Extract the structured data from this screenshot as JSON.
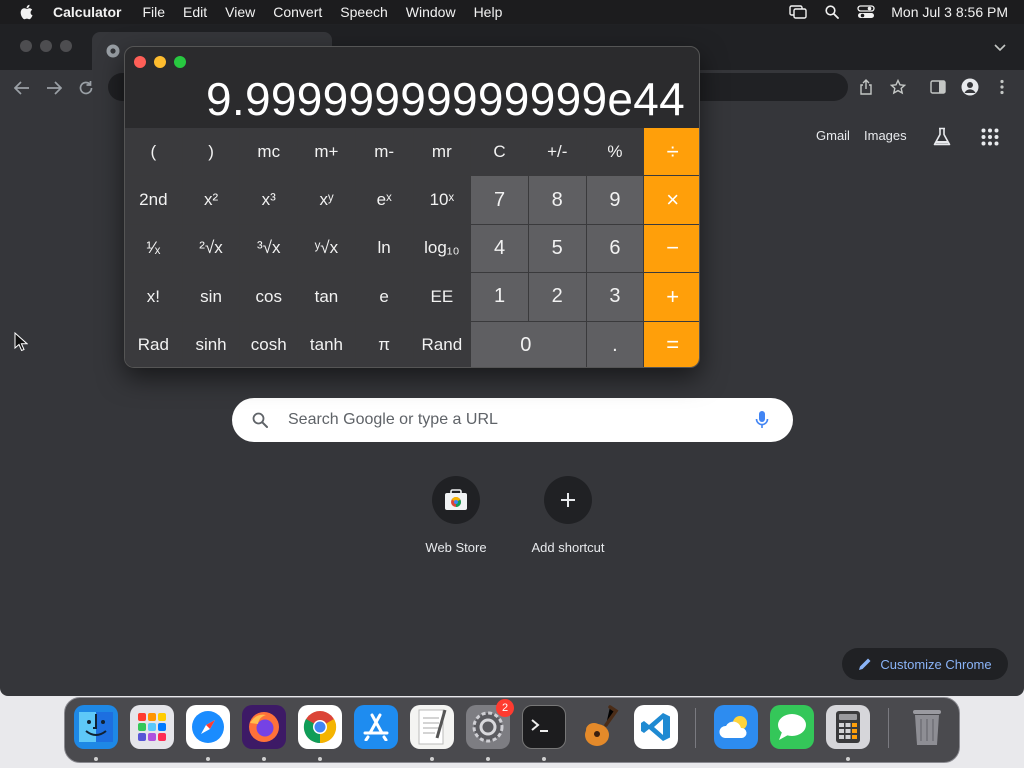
{
  "menubar": {
    "app_name": "Calculator",
    "items": [
      "File",
      "Edit",
      "View",
      "Convert",
      "Speech",
      "Window",
      "Help"
    ],
    "clock": "Mon Jul 3  8:56 PM",
    "icons": [
      "apple-icon",
      "screen-mirroring-icon",
      "spotlight-search-icon",
      "control-center-icon"
    ]
  },
  "calculator": {
    "display": "9.99999999999999e44",
    "rows": [
      [
        {
          "label": "("
        },
        {
          "label": ")"
        },
        {
          "label": "mc"
        },
        {
          "label": "m+"
        },
        {
          "label": "m-"
        },
        {
          "label": "mr"
        },
        {
          "label": "C"
        },
        {
          "label": "+/-"
        },
        {
          "label": "%"
        },
        {
          "label": "÷"
        }
      ],
      [
        {
          "label": "2nd"
        },
        {
          "label": "x²"
        },
        {
          "label": "x³"
        },
        {
          "label": "xʸ"
        },
        {
          "label": "eˣ"
        },
        {
          "label": "10ˣ"
        },
        {
          "label": "7"
        },
        {
          "label": "8"
        },
        {
          "label": "9"
        },
        {
          "label": "×"
        }
      ],
      [
        {
          "label": "¹⁄ₓ"
        },
        {
          "label": "²√x"
        },
        {
          "label": "³√x"
        },
        {
          "label": "ʸ√x"
        },
        {
          "label": "ln"
        },
        {
          "label": "log₁₀"
        },
        {
          "label": "4"
        },
        {
          "label": "5"
        },
        {
          "label": "6"
        },
        {
          "label": "−"
        }
      ],
      [
        {
          "label": "x!"
        },
        {
          "label": "sin"
        },
        {
          "label": "cos"
        },
        {
          "label": "tan"
        },
        {
          "label": "e"
        },
        {
          "label": "EE"
        },
        {
          "label": "1"
        },
        {
          "label": "2"
        },
        {
          "label": "3"
        },
        {
          "label": "+"
        }
      ],
      [
        {
          "label": "Rad"
        },
        {
          "label": "sinh"
        },
        {
          "label": "cosh"
        },
        {
          "label": "tanh"
        },
        {
          "label": "π"
        },
        {
          "label": "Rand"
        },
        {
          "label": "0"
        },
        {
          "label": "."
        },
        {
          "label": "="
        }
      ]
    ]
  },
  "chrome": {
    "header_links": {
      "gmail": "Gmail",
      "images": "Images"
    },
    "search": {
      "placeholder": "Search Google or type a URL"
    },
    "shortcuts": [
      {
        "label": "Web Store"
      },
      {
        "label": "Add shortcut"
      }
    ],
    "customize_label": "Customize Chrome"
  },
  "dock": {
    "apps": [
      "finder",
      "launchpad",
      "safari",
      "firefox",
      "chrome",
      "app-store",
      "textedit",
      "system-settings",
      "terminal",
      "garageband",
      "vscode",
      "weather",
      "messages",
      "calculator",
      "trash"
    ],
    "settings_badge": "2"
  },
  "colors": {
    "accent_orange": "#ff9f0a",
    "chrome_bg": "#35363a",
    "chrome_link_blue": "#8ab4f8"
  }
}
